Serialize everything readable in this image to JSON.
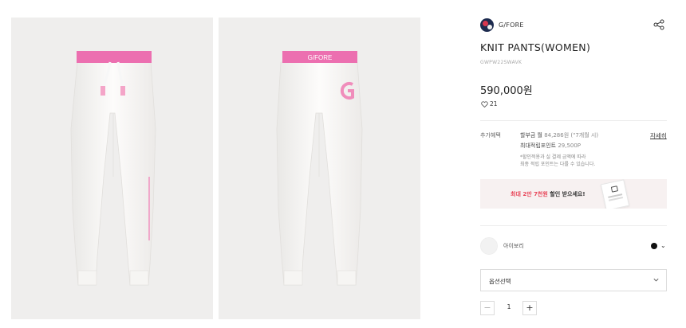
{
  "brand": {
    "name": "G/FORE",
    "logo_icon": "brand-logo-icon"
  },
  "share": {
    "icon": "share-icon"
  },
  "product": {
    "title": "KNIT PANTS(WOMEN)",
    "code": "GWPW22SWAVK",
    "price": "590,000원",
    "likes_count": "21",
    "waistband_text": "G/FORE"
  },
  "benefits": {
    "label": "추가혜택",
    "installment_prefix": "할부금 월",
    "installment_amount": " 84,286원 (\"7개월 시)",
    "points_prefix": "최대적립포인트",
    "points_amount": " 29,500P",
    "note_line1": "*할인적용과 실 결제 금액에 따라",
    "note_line2": "최종 적립 포인트는 다를 수 있습니다.",
    "detail_link": "자세히"
  },
  "promo": {
    "highlight": "최대 2만 7천원",
    "text": " 할인 받으세요!"
  },
  "color_option": {
    "name": "아이보리",
    "selected_color": "#111111"
  },
  "option_select": {
    "label": "옵션선택"
  },
  "quantity": {
    "value": "1",
    "minus": "−",
    "plus": "+"
  },
  "colors": {
    "accent_pink": "#e8475a",
    "waistband_pink": "#ec6fb0",
    "pants": "#fbfaf8"
  }
}
